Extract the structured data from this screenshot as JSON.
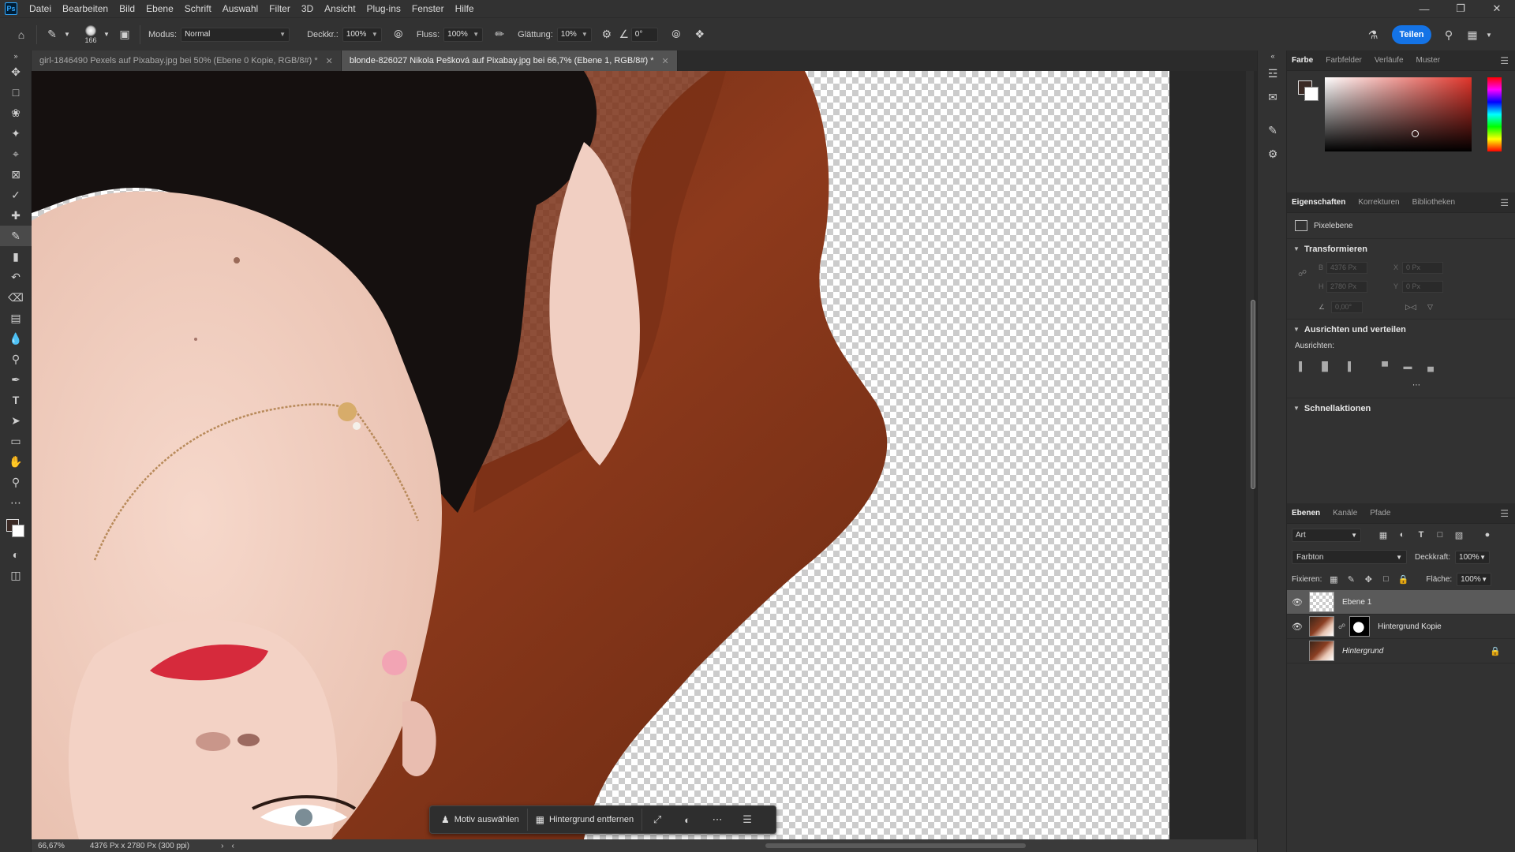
{
  "menubar": {
    "logo": "Ps",
    "items": [
      "Datei",
      "Bearbeiten",
      "Bild",
      "Ebene",
      "Schrift",
      "Auswahl",
      "Filter",
      "3D",
      "Ansicht",
      "Plug-ins",
      "Fenster",
      "Hilfe"
    ]
  },
  "options": {
    "brush_size": "166",
    "mode_label": "Modus:",
    "mode_value": "Normal",
    "opacity_label": "Deckkr.:",
    "opacity_value": "100%",
    "flow_label": "Fluss:",
    "flow_value": "100%",
    "smoothing_label": "Glättung:",
    "smoothing_value": "10%",
    "angle_value": "0°",
    "share_label": "Teilen"
  },
  "tabs": [
    {
      "label": "girl-1846490 Pexels auf Pixabay.jpg bei 50% (Ebene 0 Kopie, RGB/8#) *",
      "active": false
    },
    {
      "label": "blonde-826027 Nikola Pešková auf Pixabay.jpg bei 66,7% (Ebene 1, RGB/8#) *",
      "active": true
    }
  ],
  "contextbar": {
    "select_subject": "Motiv auswählen",
    "remove_background": "Hintergrund entfernen"
  },
  "status": {
    "zoom": "66,67%",
    "doc_info": "4376 Px x 2780 Px (300 ppi)"
  },
  "color_panel": {
    "tabs": [
      "Farbe",
      "Farbfelder",
      "Verläufe",
      "Muster"
    ],
    "foreground": "#3b2a25",
    "background": "#ffffff"
  },
  "properties_panel": {
    "tabs": [
      "Eigenschaften",
      "Korrekturen",
      "Bibliotheken"
    ],
    "layer_type": "Pixelebene",
    "transform_title": "Transformieren",
    "transform": {
      "w": "4376 Px",
      "h": "2780 Px",
      "x": "0 Px",
      "y": "0 Px",
      "angle": "0,00°",
      "w_lbl": "B",
      "h_lbl": "H",
      "x_lbl": "X",
      "y_lbl": "Y"
    },
    "align_title": "Ausrichten und verteilen",
    "align_label": "Ausrichten:",
    "quick_actions_title": "Schnellaktionen"
  },
  "layers_panel": {
    "tabs": [
      "Ebenen",
      "Kanäle",
      "Pfade"
    ],
    "kind_filter": "Art",
    "blend_mode": "Farbton",
    "opacity_label": "Deckkraft:",
    "opacity_value": "100%",
    "lock_label": "Fixieren:",
    "fill_label": "Fläche:",
    "fill_value": "100%",
    "layers": [
      {
        "name": "Ebene 1",
        "visible": true,
        "selected": true
      },
      {
        "name": "Hintergrund Kopie",
        "visible": true,
        "selected": false
      },
      {
        "name": "Hintergrund",
        "visible": false,
        "selected": false,
        "locked": true
      }
    ]
  }
}
